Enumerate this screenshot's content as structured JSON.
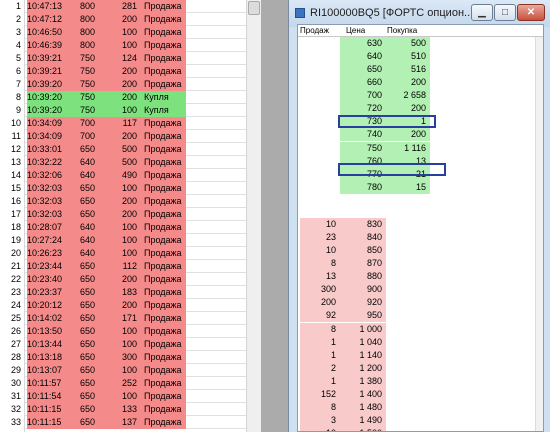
{
  "trades": {
    "rows": [
      {
        "n": "1",
        "time": "10:47:13",
        "price": "800",
        "qty": "281",
        "side": "Продажа",
        "type": "sell"
      },
      {
        "n": "2",
        "time": "10:47:12",
        "price": "800",
        "qty": "200",
        "side": "Продажа",
        "type": "sell"
      },
      {
        "n": "3",
        "time": "10:46:50",
        "price": "800",
        "qty": "100",
        "side": "Продажа",
        "type": "sell"
      },
      {
        "n": "4",
        "time": "10:46:39",
        "price": "800",
        "qty": "100",
        "side": "Продажа",
        "type": "sell"
      },
      {
        "n": "5",
        "time": "10:39:21",
        "price": "750",
        "qty": "124",
        "side": "Продажа",
        "type": "sell"
      },
      {
        "n": "6",
        "time": "10:39:21",
        "price": "750",
        "qty": "200",
        "side": "Продажа",
        "type": "sell"
      },
      {
        "n": "7",
        "time": "10:39:20",
        "price": "750",
        "qty": "200",
        "side": "Продажа",
        "type": "sell"
      },
      {
        "n": "8",
        "time": "10:39:20",
        "price": "750",
        "qty": "200",
        "side": "Купля",
        "type": "buy"
      },
      {
        "n": "9",
        "time": "10:39:20",
        "price": "750",
        "qty": "100",
        "side": "Купля",
        "type": "buy"
      },
      {
        "n": "10",
        "time": "10:34:09",
        "price": "700",
        "qty": "117",
        "side": "Продажа",
        "type": "sell"
      },
      {
        "n": "11",
        "time": "10:34:09",
        "price": "700",
        "qty": "200",
        "side": "Продажа",
        "type": "sell"
      },
      {
        "n": "12",
        "time": "10:33:01",
        "price": "650",
        "qty": "500",
        "side": "Продажа",
        "type": "sell"
      },
      {
        "n": "13",
        "time": "10:32:22",
        "price": "640",
        "qty": "500",
        "side": "Продажа",
        "type": "sell"
      },
      {
        "n": "14",
        "time": "10:32:06",
        "price": "640",
        "qty": "490",
        "side": "Продажа",
        "type": "sell"
      },
      {
        "n": "15",
        "time": "10:32:03",
        "price": "650",
        "qty": "100",
        "side": "Продажа",
        "type": "sell"
      },
      {
        "n": "16",
        "time": "10:32:03",
        "price": "650",
        "qty": "200",
        "side": "Продажа",
        "type": "sell"
      },
      {
        "n": "17",
        "time": "10:32:03",
        "price": "650",
        "qty": "200",
        "side": "Продажа",
        "type": "sell"
      },
      {
        "n": "18",
        "time": "10:28:07",
        "price": "640",
        "qty": "100",
        "side": "Продажа",
        "type": "sell"
      },
      {
        "n": "19",
        "time": "10:27:24",
        "price": "640",
        "qty": "100",
        "side": "Продажа",
        "type": "sell"
      },
      {
        "n": "20",
        "time": "10:26:23",
        "price": "640",
        "qty": "100",
        "side": "Продажа",
        "type": "sell"
      },
      {
        "n": "21",
        "time": "10:23:44",
        "price": "650",
        "qty": "112",
        "side": "Продажа",
        "type": "sell"
      },
      {
        "n": "22",
        "time": "10:23:40",
        "price": "650",
        "qty": "200",
        "side": "Продажа",
        "type": "sell"
      },
      {
        "n": "23",
        "time": "10:23:37",
        "price": "650",
        "qty": "183",
        "side": "Продажа",
        "type": "sell"
      },
      {
        "n": "24",
        "time": "10:20:12",
        "price": "650",
        "qty": "200",
        "side": "Продажа",
        "type": "sell"
      },
      {
        "n": "25",
        "time": "10:14:02",
        "price": "650",
        "qty": "171",
        "side": "Продажа",
        "type": "sell"
      },
      {
        "n": "26",
        "time": "10:13:50",
        "price": "650",
        "qty": "100",
        "side": "Продажа",
        "type": "sell"
      },
      {
        "n": "27",
        "time": "10:13:44",
        "price": "650",
        "qty": "100",
        "side": "Продажа",
        "type": "sell"
      },
      {
        "n": "28",
        "time": "10:13:18",
        "price": "650",
        "qty": "300",
        "side": "Продажа",
        "type": "sell"
      },
      {
        "n": "29",
        "time": "10:13:07",
        "price": "650",
        "qty": "100",
        "side": "Продажа",
        "type": "sell"
      },
      {
        "n": "30",
        "time": "10:11:57",
        "price": "650",
        "qty": "252",
        "side": "Продажа",
        "type": "sell"
      },
      {
        "n": "31",
        "time": "10:11:54",
        "price": "650",
        "qty": "100",
        "side": "Продажа",
        "type": "sell"
      },
      {
        "n": "32",
        "time": "10:11:15",
        "price": "650",
        "qty": "133",
        "side": "Продажа",
        "type": "sell"
      },
      {
        "n": "33",
        "time": "10:11:15",
        "price": "650",
        "qty": "137",
        "side": "Продажа",
        "type": "sell"
      }
    ]
  },
  "window": {
    "title": "RI100000BQ5 [ФОРТС опцион...",
    "min_label": "▁",
    "max_label": "□",
    "close_label": "✕"
  },
  "book": {
    "headers": {
      "bid": "Продаж",
      "price": "Цена",
      "ask": "Покупка"
    },
    "asks": [
      {
        "price": "630",
        "qty": "500"
      },
      {
        "price": "640",
        "qty": "510"
      },
      {
        "price": "650",
        "qty": "516"
      },
      {
        "price": "660",
        "qty": "200"
      },
      {
        "price": "700",
        "qty": "2 658"
      },
      {
        "price": "720",
        "qty": "200"
      },
      {
        "price": "730",
        "qty": "1"
      },
      {
        "price": "740",
        "qty": "200"
      },
      {
        "price": "750",
        "qty": "1 116"
      },
      {
        "price": "760",
        "qty": "13"
      },
      {
        "price": "770",
        "qty": "21"
      },
      {
        "price": "780",
        "qty": "15"
      }
    ],
    "bids": [
      {
        "qty": "10",
        "price": "830"
      },
      {
        "qty": "23",
        "price": "840"
      },
      {
        "qty": "10",
        "price": "850"
      },
      {
        "qty": "8",
        "price": "870"
      },
      {
        "qty": "13",
        "price": "880"
      },
      {
        "qty": "300",
        "price": "900"
      },
      {
        "qty": "200",
        "price": "920"
      },
      {
        "qty": "92",
        "price": "950"
      },
      {
        "qty": "8",
        "price": "1 000"
      },
      {
        "qty": "1",
        "price": "1 040"
      },
      {
        "qty": "1",
        "price": "1 140"
      },
      {
        "qty": "2",
        "price": "1 200"
      },
      {
        "qty": "1",
        "price": "1 380"
      },
      {
        "qty": "152",
        "price": "1 400"
      },
      {
        "qty": "8",
        "price": "1 480"
      },
      {
        "qty": "3",
        "price": "1 490"
      },
      {
        "qty": "10",
        "price": "1 500"
      },
      {
        "qty": "1",
        "price": "1 580"
      }
    ]
  }
}
